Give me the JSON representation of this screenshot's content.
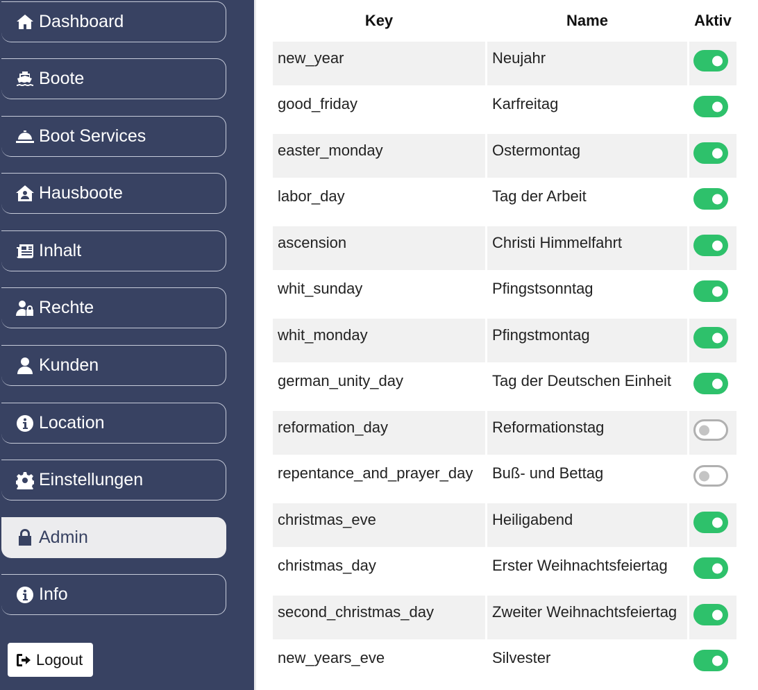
{
  "sidebar": {
    "items": [
      {
        "label": "Dashboard",
        "icon": "home-icon",
        "active": false
      },
      {
        "label": "Boote",
        "icon": "ship-icon",
        "active": false
      },
      {
        "label": "Boot Services",
        "icon": "concierge-bell-icon",
        "active": false
      },
      {
        "label": "Hausboote",
        "icon": "house-user-icon",
        "active": false
      },
      {
        "label": "Inhalt",
        "icon": "newspaper-icon",
        "active": false
      },
      {
        "label": "Rechte",
        "icon": "user-lock-icon",
        "active": false
      },
      {
        "label": "Kunden",
        "icon": "user-icon",
        "active": false
      },
      {
        "label": "Location",
        "icon": "info-circle-icon",
        "active": false
      },
      {
        "label": "Einstellungen",
        "icon": "gear-icon",
        "active": false
      },
      {
        "label": "Admin",
        "icon": "lock-icon",
        "active": true
      },
      {
        "label": "Info",
        "icon": "info-circle-icon",
        "active": false
      }
    ],
    "logout_label": "Logout",
    "logout_icon": "sign-out-icon"
  },
  "table": {
    "headers": {
      "key": "Key",
      "name": "Name",
      "active": "Aktiv"
    },
    "rows": [
      {
        "key": "new_year",
        "name": "Neujahr",
        "active": true
      },
      {
        "key": "good_friday",
        "name": "Karfreitag",
        "active": true
      },
      {
        "key": "easter_monday",
        "name": "Ostermontag",
        "active": true
      },
      {
        "key": "labor_day",
        "name": "Tag der Arbeit",
        "active": true
      },
      {
        "key": "ascension",
        "name": "Christi Himmelfahrt",
        "active": true
      },
      {
        "key": "whit_sunday",
        "name": "Pfingstsonntag",
        "active": true
      },
      {
        "key": "whit_monday",
        "name": "Pfingstmontag",
        "active": true
      },
      {
        "key": "german_unity_day",
        "name": "Tag der Deutschen Einheit",
        "active": true
      },
      {
        "key": "reformation_day",
        "name": "Reformationstag",
        "active": false
      },
      {
        "key": "repentance_and_prayer_day",
        "name": "Buß- und Bettag",
        "active": false
      },
      {
        "key": "christmas_eve",
        "name": "Heiligabend",
        "active": true
      },
      {
        "key": "christmas_day",
        "name": "Erster Weihnachtsfeiertag",
        "active": true
      },
      {
        "key": "second_christmas_day",
        "name": "Zweiter Weihnachtsfeiertag",
        "active": true
      },
      {
        "key": "new_years_eve",
        "name": "Silvester",
        "active": true
      }
    ]
  },
  "colors": {
    "sidebar_bg": "#384262",
    "toggle_on": "#2ec16b",
    "toggle_off_border": "#b0b0b0",
    "row_alt": "#f1f1f1"
  }
}
